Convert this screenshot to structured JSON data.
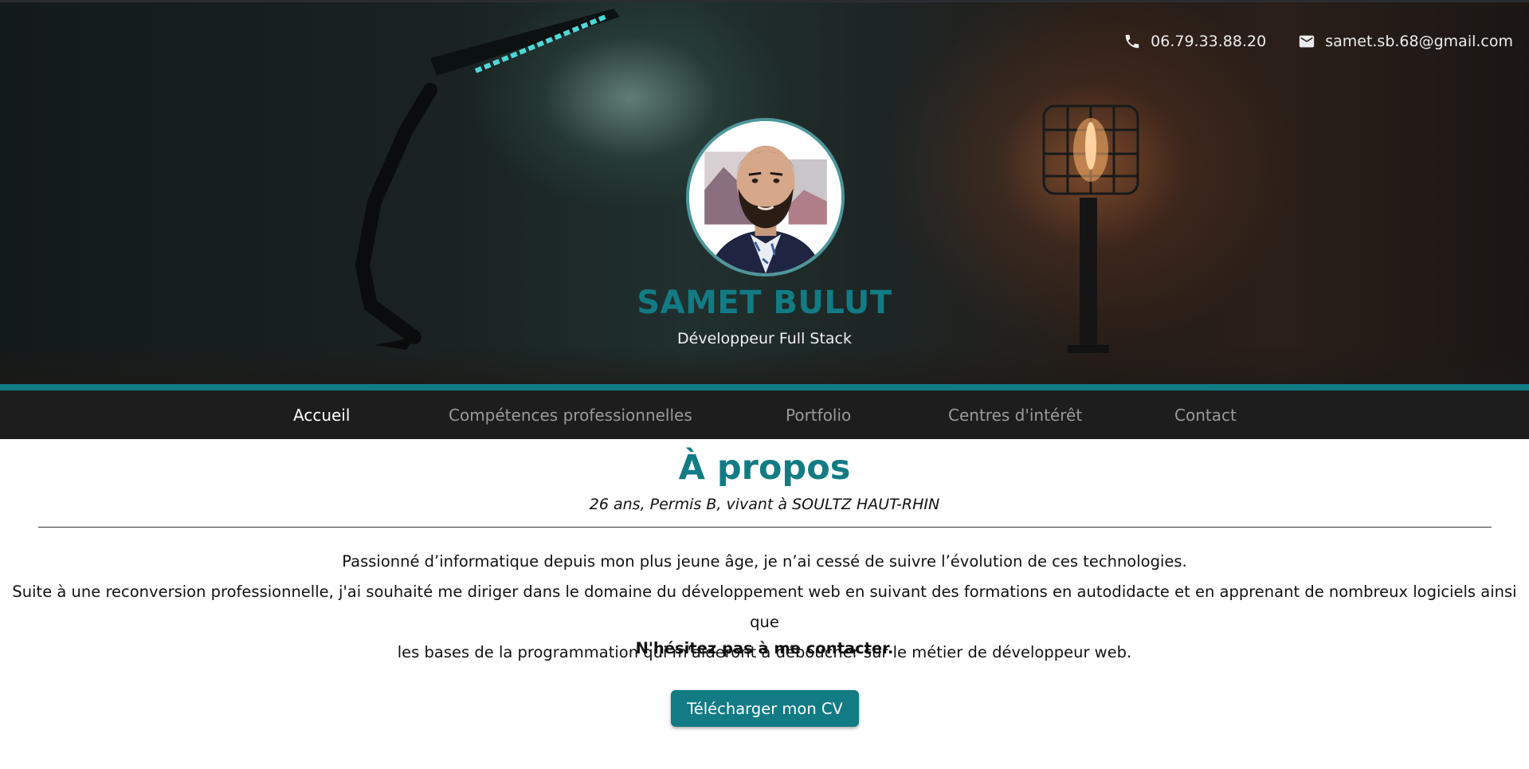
{
  "header": {
    "phone": "06.79.33.88.20",
    "email": "samet.sb.68@gmail.com",
    "name": "SAMET BULUT",
    "job_title": "Développeur Full Stack"
  },
  "nav": {
    "items": [
      {
        "label": "Accueil",
        "active": true
      },
      {
        "label": "Compétences professionnelles",
        "active": false
      },
      {
        "label": "Portfolio",
        "active": false
      },
      {
        "label": "Centres d'intérêt",
        "active": false
      },
      {
        "label": "Contact",
        "active": false
      }
    ]
  },
  "about": {
    "title": "À propos",
    "subtitle": "26 ans, Permis B, vivant à SOULTZ HAUT-RHIN",
    "paragraph_line1": "Passionné d’informatique depuis mon plus jeune âge, je n’ai cessé de suivre l’évolution de ces technologies.",
    "paragraph_line2": "Suite à une reconversion professionnelle, j'ai souhaité me diriger dans le domaine du développement web en suivant des formations en autodidacte et en apprenant de nombreux logiciels ainsi que",
    "paragraph_line3": "les bases de la programmation qui m'aideront à déboucher sur le métier de développeur web.",
    "cta_text": "N'hésitez pas à me contacter.",
    "cv_button_label": "Télécharger mon CV"
  },
  "colors": {
    "accent": "#127b84",
    "nav_background": "#1d1d1e",
    "nav_active_text": "#ffffff",
    "nav_inactive_text": "#9a9a9a"
  },
  "icons": {
    "phone": "phone-icon",
    "email": "mail-icon"
  }
}
